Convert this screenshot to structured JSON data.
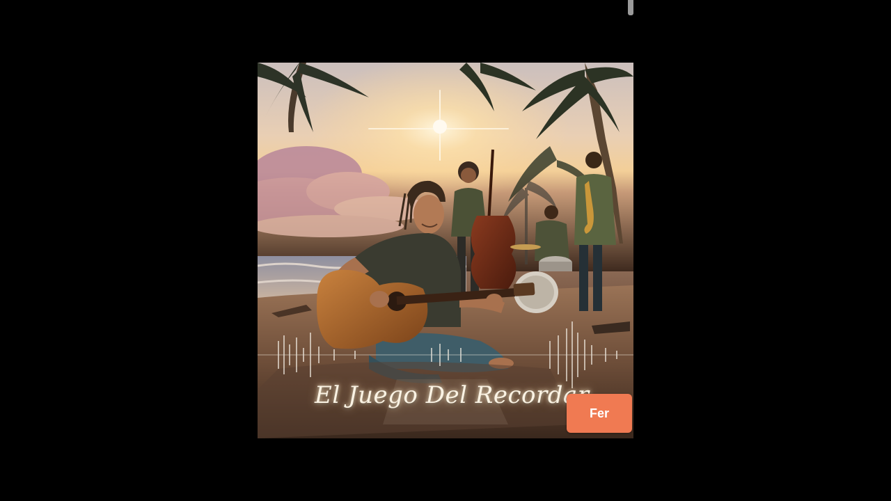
{
  "artwork": {
    "title": "El Juego Del Recordar",
    "scene": "beach-band-sunset-illustration"
  },
  "overlay_button": {
    "label": "Fer"
  },
  "colors": {
    "background": "#000000",
    "button": "#f07a52",
    "title_glow": "#fbf3e4"
  }
}
